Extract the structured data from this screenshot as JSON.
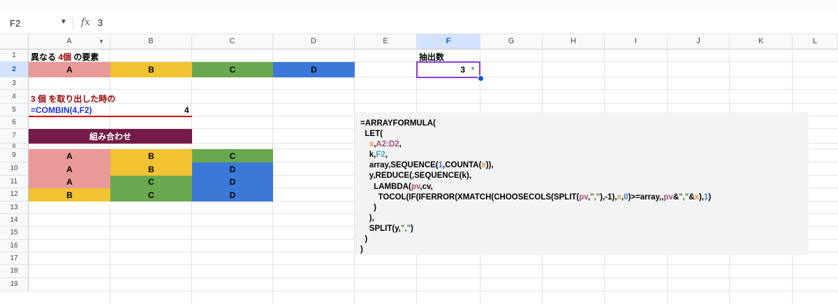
{
  "formula_bar": {
    "name_box": "F2",
    "fx": "fx",
    "value": "3"
  },
  "columns": [
    "A",
    "B",
    "C",
    "D",
    "E",
    "F",
    "G",
    "H",
    "I",
    "J",
    "K",
    "L"
  ],
  "rows": [
    "1",
    "2",
    "3",
    "4",
    "5",
    "6",
    "7",
    "8",
    "9",
    "10",
    "11",
    "12",
    "13",
    "14",
    "15",
    "16",
    "17",
    "18",
    "19"
  ],
  "selected_column": "F",
  "selected_row": "2",
  "cells": {
    "a1_pre": "異なる",
    "a1_num": "4個",
    "a1_post": "の要素",
    "f1": "抽出数",
    "f2": "3",
    "row2": [
      "A",
      "B",
      "C",
      "D"
    ],
    "a4": "3 個 を取り出した時の",
    "a5": "=COMBIN(4,F2)",
    "c5": "4",
    "a7": "組み合わせ",
    "combos": [
      [
        "A",
        "B",
        "C"
      ],
      [
        "A",
        "B",
        "D"
      ],
      [
        "A",
        "C",
        "D"
      ],
      [
        "B",
        "C",
        "D"
      ]
    ]
  },
  "colors": {
    "A": "#ea9999",
    "B": "#f1c232",
    "C": "#6aa84f",
    "D": "#3c78d8",
    "header_merge": "#741b47",
    "selection": "#8e3ad7"
  },
  "formula_text": {
    "l1": "=ARRAYFORMULA(",
    "l2": "LET(",
    "l3a": "x",
    "l3b": ",",
    "l3c": "A2:D2",
    "l3d": ",",
    "l4a": "k,",
    "l4b": "F2",
    "l4c": ",",
    "l5a": "array,SEQUENCE(",
    "l5b": "1",
    "l5c": ",COUNTA(",
    "l5d": "x",
    "l5e": ")),",
    "l6": "y,REDUCE(,SEQUENCE(k),",
    "l7a": "LAMBDA(",
    "l7b": "pv",
    "l7c": ",cv,",
    "l8a": "TOCOL(IF(IFERROR(XMATCH(CHOOSECOLS(SPLIT(",
    "l8b": "pv",
    "l8c": ",",
    "l8d": "\",\"",
    "l8e": "),-1),",
    "l8f": "x",
    "l8g": ",",
    "l8h": "0",
    "l8i": ")>=array,,",
    "l8j": "pv",
    "l8k": "&",
    "l8l": "\",\"",
    "l8m": "&",
    "l8n": "x",
    "l8o": "),",
    "l8p": "1",
    "l8q": ")",
    "l9": ")",
    "l10": "),",
    "l11a": "SPLIT(y,",
    "l11b": "\",\"",
    "l11c": ")",
    "l12": ")",
    "l13": ")"
  }
}
